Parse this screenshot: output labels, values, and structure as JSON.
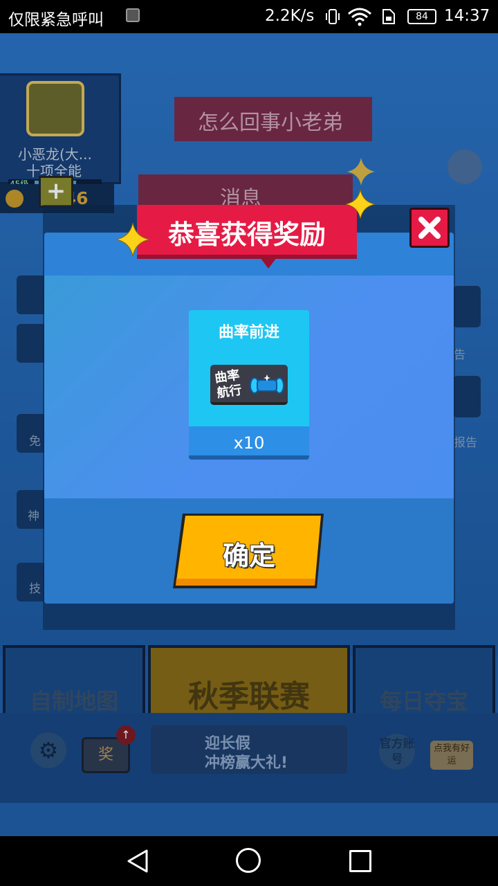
{
  "status_bar": {
    "carrier_text": "仅限紧急呼叫",
    "net_speed": "2.2K/s",
    "battery": "84",
    "time": "14:37"
  },
  "profile": {
    "name": "小恶龙(大...",
    "title": "十项全能",
    "level": "45级",
    "level_progress": 0.6,
    "coins": "5046",
    "plus": "+"
  },
  "background": {
    "speech_banner": "怎么回事小老弟",
    "message_banner": "消息",
    "side_left": [
      "免",
      "神",
      "技"
    ],
    "side_right": [
      "告",
      "报告"
    ]
  },
  "game_buttons": {
    "custom_map": "自制地图",
    "autumn_league": "秋季联赛",
    "daily_treasure": "每日夺宝"
  },
  "bottom_bar": {
    "gear_icon": "⚙",
    "tv_label": "奖",
    "ad_line1": "迎长假",
    "ad_line2": "冲榜赢大礼!",
    "official_account": "官方账号",
    "luck_button": "点我有好运"
  },
  "dialog": {
    "title": "恭喜获得奖励",
    "reward": {
      "name": "曲率前进",
      "icon_text": "曲率航行",
      "count": "x10"
    },
    "confirm": "确定",
    "colors": {
      "banner": "#e51a45",
      "confirm": "#ffb400",
      "card": "#1ec6f4"
    }
  }
}
